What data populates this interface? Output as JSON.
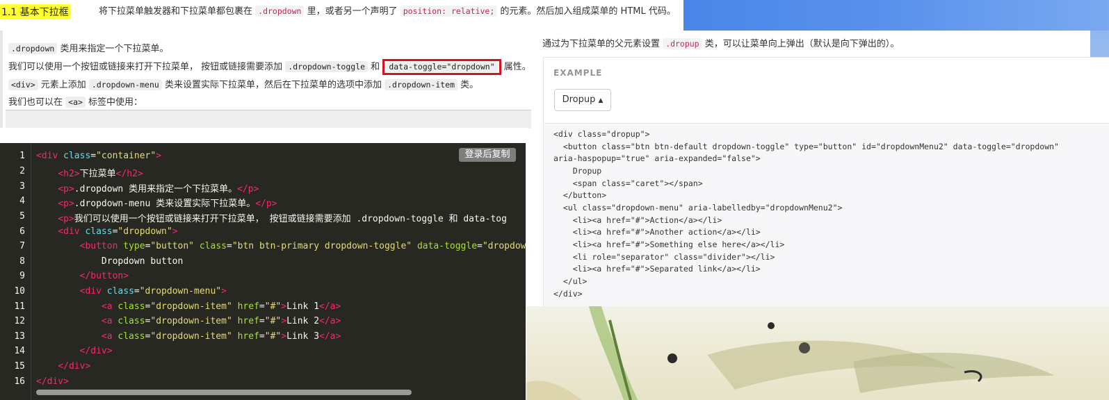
{
  "heading": {
    "title": "1.1 基本下拉框"
  },
  "intro": {
    "text_before": "将下拉菜单触发器和下拉菜单都包裹在 ",
    "code1": ".dropdown",
    "text_mid": " 里，或者另一个声明了 ",
    "code2": "position: relative;",
    "text_after": " 的元素。然后加入组成菜单的 HTML 代码。"
  },
  "article": {
    "line1_code": ".dropdown",
    "line1_text": " 类用来指定一个下拉菜单。",
    "line2_text_a": "我们可以使用一个按钮或链接来打开下拉菜单， 按钮或链接需要添加 ",
    "line2_code1": ".dropdown-toggle",
    "line2_text_b": " 和 ",
    "line2_code2": "data-toggle=\"dropdown\"",
    "line2_text_c": " 属性。",
    "line3_code1": "<div>",
    "line3_text_a": " 元素上添加 ",
    "line3_code2": ".dropdown-menu",
    "line3_text_b": " 类来设置实际下拉菜单，然后在下拉菜单的选项中添加 ",
    "line3_code3": ".dropdown-item",
    "line3_text_c": " 类。",
    "line4_text_a": "我们也可以在 ",
    "line4_code": "<a>",
    "line4_text_b": " 标签中使用："
  },
  "editor": {
    "copy_button": "登录后复制",
    "lines": [
      {
        "n": "1"
      },
      {
        "n": "2"
      },
      {
        "n": "3"
      },
      {
        "n": "4"
      },
      {
        "n": "5"
      },
      {
        "n": "6"
      },
      {
        "n": "7"
      },
      {
        "n": "8"
      },
      {
        "n": "9"
      },
      {
        "n": "10"
      },
      {
        "n": "11"
      },
      {
        "n": "12"
      },
      {
        "n": "13"
      },
      {
        "n": "14"
      },
      {
        "n": "15"
      },
      {
        "n": "16"
      }
    ],
    "code": {
      "l1": "<div class=\"container\">",
      "l2_text": "下拉菜单",
      "l3_text": ".dropdown 类用来指定一个下拉菜单。",
      "l4_text": ".dropdown-menu 类来设置实际下拉菜单。",
      "l5_text": "我们可以使用一个按钮或链接来打开下拉菜单， 按钮或链接需要添加 .dropdown-toggle 和 data-tog",
      "l7_text": "btn btn-primary dropdown-toggle",
      "l8_text": "Dropdown button",
      "l11_text": "Link 1",
      "l12_text": "Link 2",
      "l13_text": "Link 3"
    }
  },
  "dropup": {
    "intro_a": "通过为下拉菜单的父元素设置 ",
    "intro_code": ".dropup",
    "intro_b": " 类，可以让菜单向上弹出（默认是向下弹出的）。",
    "example_label": "EXAMPLE",
    "button_label": "Dropup",
    "code": {
      "l1": "<div class=\"dropup\">",
      "l2": "  <button class=\"btn btn-default dropdown-toggle\" type=\"button\" id=\"dropdownMenu2\" data-toggle=\"dropdown\"",
      "l3": "aria-haspopup=\"true\" aria-expanded=\"false\">",
      "l4": "    Dropup",
      "l5": "    <span class=\"caret\"></span>",
      "l6": "  </button>",
      "l7": "  <ul class=\"dropdown-menu\" aria-labelledby=\"dropdownMenu2\">",
      "l8": "    <li><a href=\"#\">Action</a></li>",
      "l9": "    <li><a href=\"#\">Another action</a></li>",
      "l10": "    <li><a href=\"#\">Something else here</a></li>",
      "l11": "    <li role=\"separator\" class=\"divider\"></li>",
      "l12": "    <li><a href=\"#\">Separated link</a></li>",
      "l13": "  </ul>",
      "l14": "</div>"
    }
  },
  "colors": {
    "highlight_yellow": "#ffff33",
    "highlight_box": "#d9111b",
    "editor_bg": "#272822",
    "banner_blue": "#4a86e8"
  }
}
